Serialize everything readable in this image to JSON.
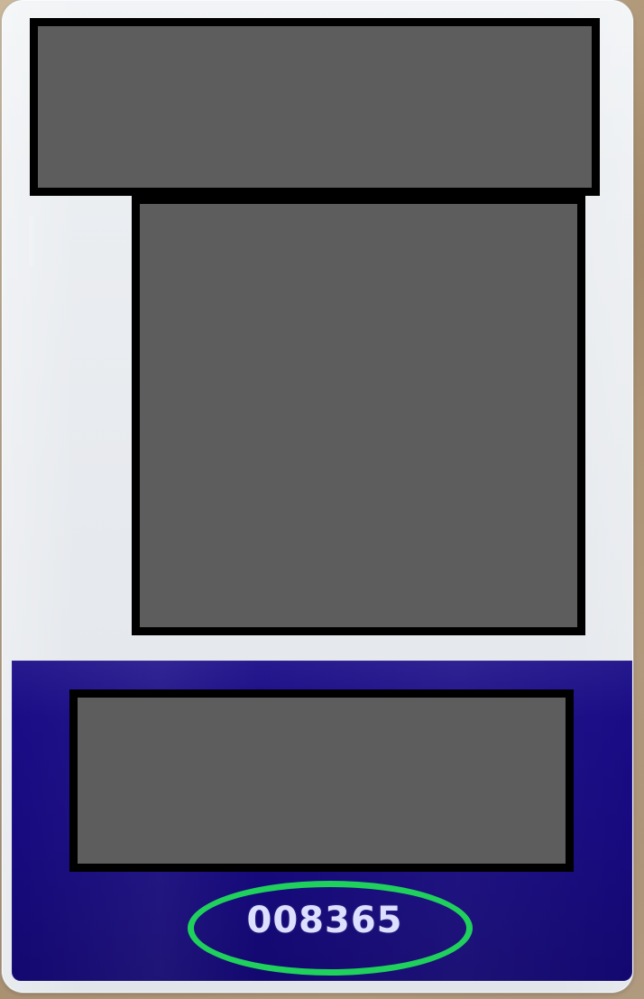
{
  "photo": {
    "background_color": "#b9a58a",
    "card_color": "#e9ecef",
    "band_color": "#170a7f",
    "redaction_fill": "#5d5d5d",
    "redaction_border": "#000000",
    "highlight_color": "#1fd05d"
  },
  "card": {
    "serial_number": "008365"
  }
}
